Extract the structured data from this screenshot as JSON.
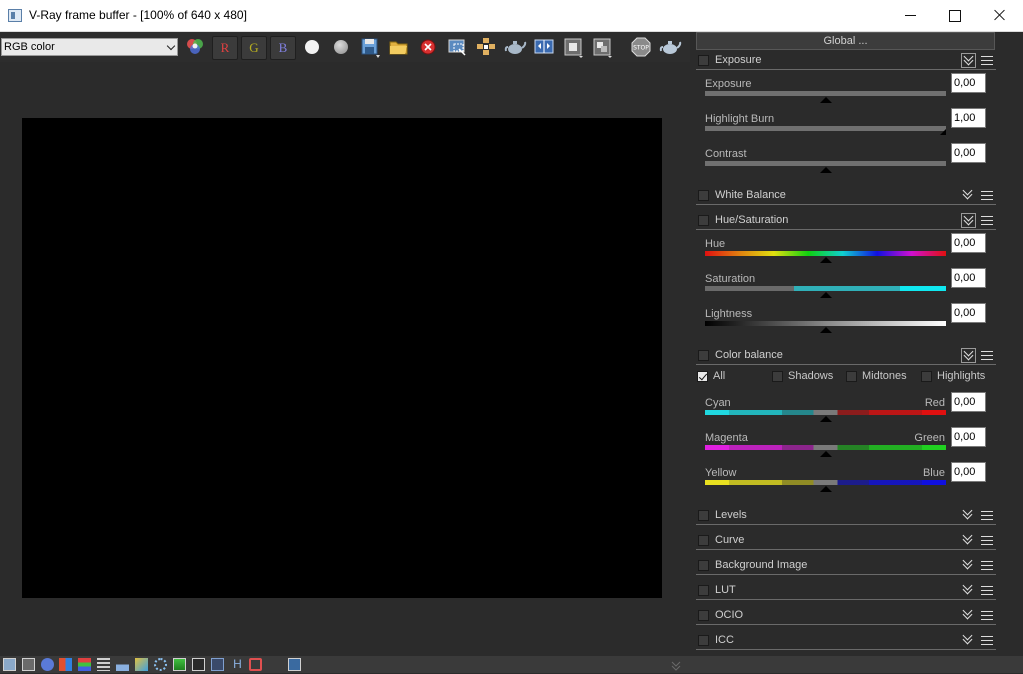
{
  "window": {
    "title": "V-Ray frame buffer - [100% of 640 x 480]",
    "controls": [
      "minimize-icon",
      "maximize-icon",
      "close-icon"
    ]
  },
  "toolbar": {
    "channel_select": {
      "value": "RGB color"
    },
    "channel_buttons": [
      {
        "label": "R",
        "color": "#e04040"
      },
      {
        "label": "G",
        "color": "#b8b020"
      },
      {
        "label": "B",
        "color": "#8080e0"
      }
    ],
    "icons": [
      "color-wheels-icon",
      "white-circle-icon",
      "grey-circle-icon",
      "save-icon",
      "open-folder-icon",
      "clear-icon",
      "region-render-icon",
      "track-mouse-icon",
      "teapot-icon",
      "compare-icon",
      "lens-effects-icon",
      "render-elements-icon",
      "stop-icon",
      "render-teapot-icon"
    ]
  },
  "panel": {
    "global_label": "Global ...",
    "exposure": {
      "title": "Exposure",
      "params": [
        {
          "label": "Exposure",
          "value": "0,00",
          "level": 0.5
        },
        {
          "label": "Highlight Burn",
          "value": "1,00",
          "level": 1.0
        },
        {
          "label": "Contrast",
          "value": "0,00",
          "level": 0.5
        }
      ]
    },
    "white_balance": {
      "title": "White Balance"
    },
    "hue_saturation": {
      "title": "Hue/Saturation",
      "params": [
        {
          "label": "Hue",
          "value": "0,00",
          "level": 0.5
        },
        {
          "label": "Saturation",
          "value": "0,00",
          "level": 0.5
        },
        {
          "label": "Lightness",
          "value": "0,00",
          "level": 0.5
        }
      ]
    },
    "color_balance": {
      "title": "Color balance",
      "ranges": [
        {
          "label": "All",
          "checked": true
        },
        {
          "label": "Shadows",
          "checked": false
        },
        {
          "label": "Midtones",
          "checked": false
        },
        {
          "label": "Highlights",
          "checked": false
        }
      ],
      "params": [
        {
          "label": "Cyan",
          "right_label": "Red",
          "value": "0,00",
          "level": 0.5,
          "left_color": "#20d8e0",
          "right_color": "#e01010"
        },
        {
          "label": "Magenta",
          "right_label": "Green",
          "value": "0,00",
          "level": 0.5,
          "left_color": "#e020e0",
          "right_color": "#20d020"
        },
        {
          "label": "Yellow",
          "right_label": "Blue",
          "value": "0,00",
          "level": 0.5,
          "left_color": "#e8e020",
          "right_color": "#1010e0"
        }
      ]
    },
    "levels": {
      "title": "Levels"
    },
    "curve": {
      "title": "Curve"
    },
    "background_image": {
      "title": "Background Image"
    },
    "lut": {
      "title": "LUT"
    },
    "ocio": {
      "title": "OCIO"
    },
    "icc": {
      "title": "ICC"
    }
  },
  "statusbar": {
    "icons": [
      "show-panel-icon",
      "history-icon",
      "info-icon",
      "color-clamp-icon",
      "pixel-info-icon",
      "stats-icon",
      "histogram-icon",
      "lens-icon",
      "dispersion-icon",
      "test-resolution-icon",
      "follow-mouse-icon",
      "lut-icon",
      "hdr-icon",
      "bucket-icon",
      "stamp-icon"
    ]
  }
}
